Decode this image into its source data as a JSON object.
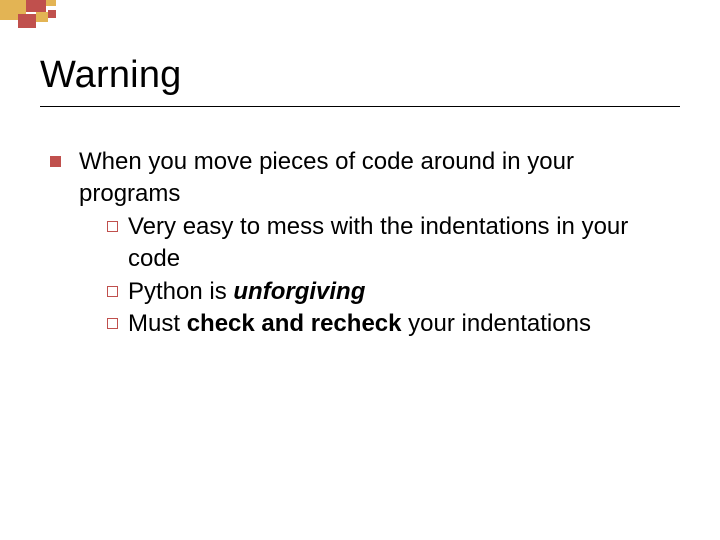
{
  "title": "Warning",
  "bullets": [
    {
      "text": "When you move pieces of code around in your programs",
      "subs": [
        {
          "parts": [
            "Very easy to mess with the indentations in your code"
          ]
        },
        {
          "parts": [
            "Python is",
            "unforgiving"
          ]
        },
        {
          "parts": [
            "Must",
            "check and recheck",
            "your indentations"
          ]
        }
      ]
    }
  ],
  "colors": {
    "accent": "#c0504d",
    "accent2": "#e3b454"
  }
}
